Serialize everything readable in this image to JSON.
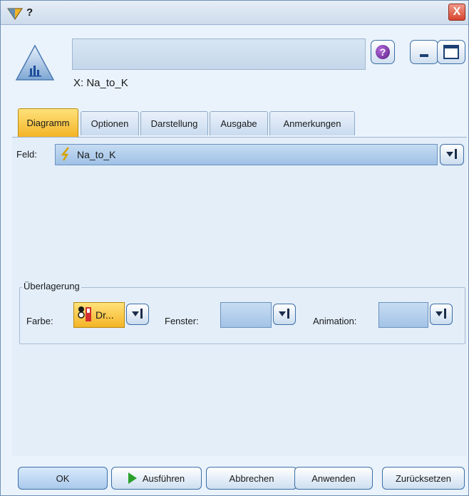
{
  "window": {
    "title": "?",
    "close_label": "X"
  },
  "header": {
    "node_name_value": "",
    "node_label": "X: Na_to_K",
    "help_label": "?"
  },
  "tabs": [
    {
      "label": "Diagramm",
      "active": true
    },
    {
      "label": "Optionen",
      "active": false
    },
    {
      "label": "Darstellung",
      "active": false
    },
    {
      "label": "Ausgabe",
      "active": false
    },
    {
      "label": "Anmerkungen",
      "active": false
    }
  ],
  "field": {
    "label": "Feld:",
    "value": "Na_to_K",
    "type_icon": "range-field-icon"
  },
  "overlay": {
    "title": "Überlagerung",
    "color_label": "Farbe:",
    "color_value": "Dr...",
    "panel_label": "Fenster:",
    "panel_value": "",
    "animation_label": "Animation:",
    "animation_value": ""
  },
  "buttons": {
    "ok": "OK",
    "run": "Ausführen",
    "cancel": "Abbrechen",
    "apply": "Anwenden",
    "reset": "Zurücksetzen"
  },
  "colors": {
    "accent_tab": "#f4b427",
    "field_blue": "#9fc1e6",
    "window_bg": "#eaf3fc",
    "run_green": "#2aa02a"
  }
}
